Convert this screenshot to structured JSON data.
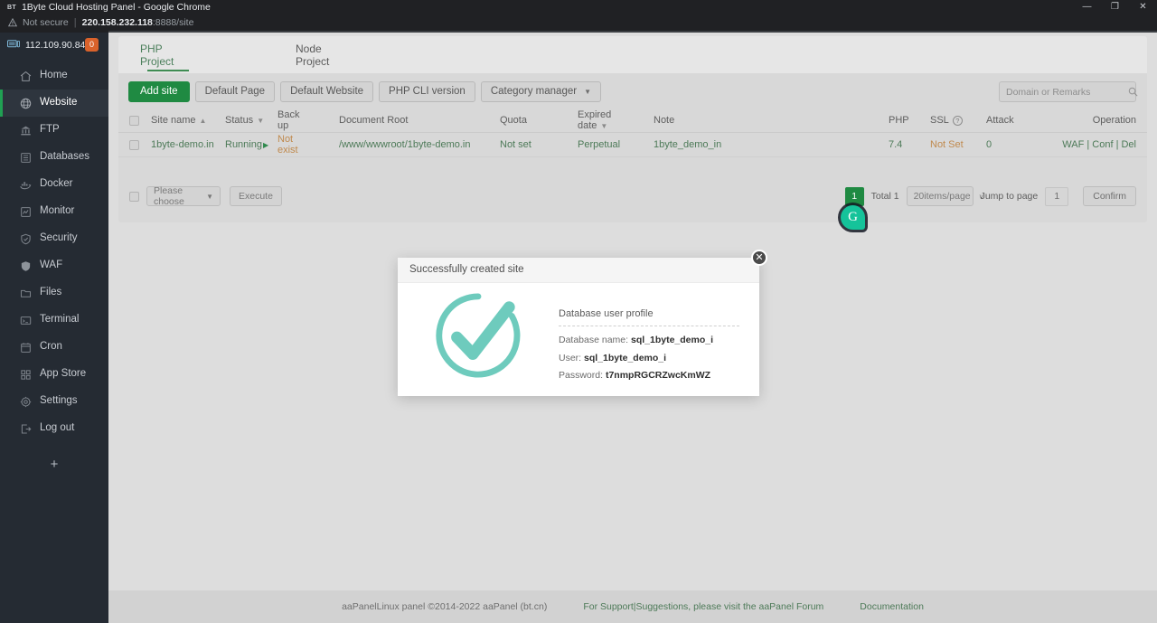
{
  "browser": {
    "favicon_label": "BT",
    "window_title": "1Byte Cloud Hosting Panel - Google Chrome",
    "security_label": "Not secure",
    "url_separator": "|",
    "url_host": "220.158.232.118",
    "url_rest": ":8888/site",
    "minimize_glyph": "—",
    "maximize_glyph": "❐",
    "close_glyph": "✕"
  },
  "sidebar": {
    "server_ip": "112.109.90.84",
    "badge_count": "0",
    "add_glyph": "+",
    "items": [
      {
        "label": "Home",
        "icon": "home-icon",
        "active": false
      },
      {
        "label": "Website",
        "icon": "globe-icon",
        "active": true
      },
      {
        "label": "FTP",
        "icon": "ftp-icon",
        "active": false
      },
      {
        "label": "Databases",
        "icon": "database-icon",
        "active": false
      },
      {
        "label": "Docker",
        "icon": "docker-icon",
        "active": false
      },
      {
        "label": "Monitor",
        "icon": "monitor-icon",
        "active": false
      },
      {
        "label": "Security",
        "icon": "shield-icon",
        "active": false
      },
      {
        "label": "WAF",
        "icon": "waf-shield-icon",
        "active": false
      },
      {
        "label": "Files",
        "icon": "folder-icon",
        "active": false
      },
      {
        "label": "Terminal",
        "icon": "terminal-icon",
        "active": false
      },
      {
        "label": "Cron",
        "icon": "calendar-icon",
        "active": false
      },
      {
        "label": "App Store",
        "icon": "grid-icon",
        "active": false
      },
      {
        "label": "Settings",
        "icon": "gear-icon",
        "active": false
      },
      {
        "label": "Log out",
        "icon": "logout-icon",
        "active": false
      }
    ]
  },
  "tabs": [
    {
      "label": "PHP Project",
      "active": true
    },
    {
      "label": "Node Project",
      "active": false
    }
  ],
  "toolbar": {
    "add_site": "Add site",
    "default_page": "Default Page",
    "default_website": "Default Website",
    "php_cli_version": "PHP CLI version",
    "category_manager": "Category manager",
    "caret_glyph": "▼"
  },
  "search": {
    "placeholder": "Domain or Remarks",
    "value": "",
    "icon": "search-icon"
  },
  "table": {
    "columns": [
      "Site name",
      "Status",
      "Back up",
      "Document Root",
      "Quota",
      "Expired date",
      "Note",
      "PHP",
      "SSL",
      "Attack",
      "Operation"
    ],
    "sort_glyph": "▲",
    "filter_glyph": "▼",
    "ssl_help_glyph": "?",
    "rows": [
      {
        "site_name": "1byte-demo.in",
        "status": "Running",
        "status_glyph": "▶",
        "backup": "Not exist",
        "document_root": "/www/wwwroot/1byte-demo.in",
        "quota": "Not set",
        "expired_date": "Perpetual",
        "note": "1byte_demo_in",
        "php": "7.4",
        "ssl": "Not Set",
        "attack": "0",
        "operation": "WAF | Conf | Del"
      }
    ]
  },
  "pagination": {
    "bulk_action_placeholder": "Please choose",
    "execute_label": "Execute",
    "current_page": "1",
    "total_label": "Total 1",
    "items_per_page": "20items/page",
    "jump_label": "Jump to page",
    "jump_value": "1",
    "confirm_label": "Confirm",
    "caret_glyph": "▼",
    "chevron_glyph": "∨"
  },
  "grammarly": {
    "glyph": "G"
  },
  "modal": {
    "title": "Successfully created site",
    "close_glyph": "✕",
    "check_icon": "success-check-icon",
    "section_title": "Database user profile",
    "fields": [
      {
        "label": "Database name:",
        "value": "sql_1byte_demo_i"
      },
      {
        "label": "User:",
        "value": "sql_1byte_demo_i"
      },
      {
        "label": "Password:",
        "value": "t7nmpRGCRZwcKmWZ"
      }
    ]
  },
  "footer": {
    "copyright": "aaPanelLinux panel ©2014-2022 aaPanel (bt.cn)",
    "support_link": "For Support|Suggestions, please visit the aaPanel Forum",
    "documentation_link": "Documentation"
  },
  "colors": {
    "accent_green": "#1f8a42",
    "sidebar_bg": "#252b33",
    "badge_orange": "#d9622b",
    "check_teal": "#66c9bb",
    "warn_orange": "#c08a4e"
  }
}
